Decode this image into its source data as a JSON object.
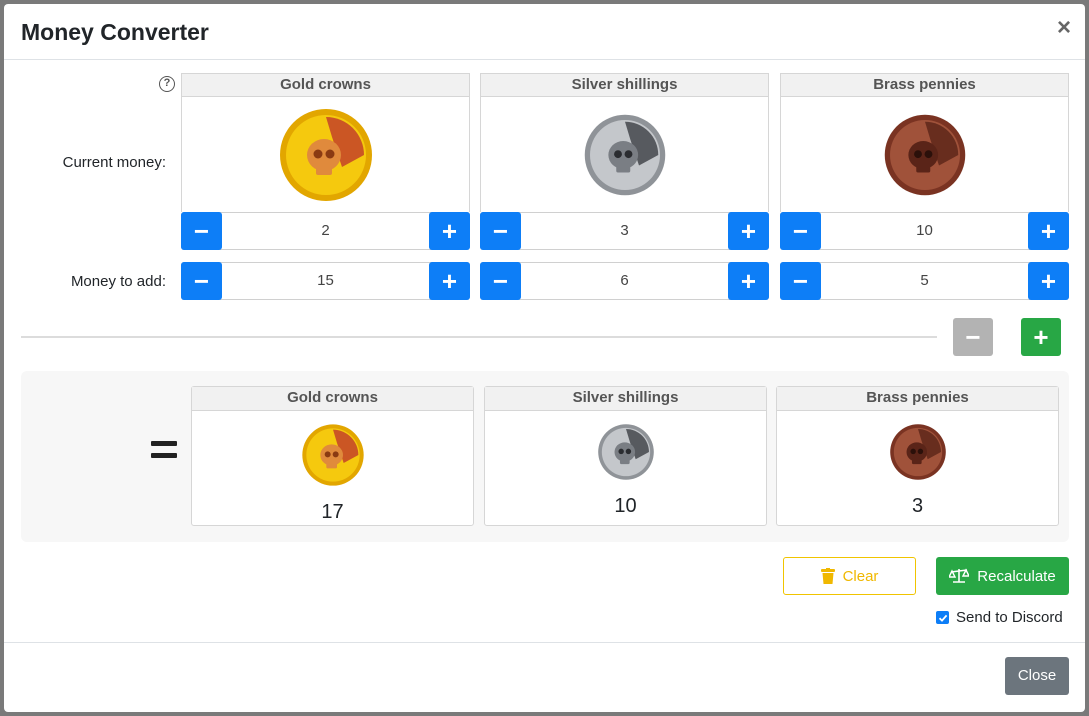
{
  "modal": {
    "title": "Money Converter",
    "close_x": "×"
  },
  "help": {
    "glyph": "?"
  },
  "labels": {
    "current": "Current money:",
    "add": "Money to add:"
  },
  "coins": [
    {
      "name": "Gold crowns",
      "color": "#f2c40c",
      "accent": "#c0392b",
      "current": "2",
      "add": "15",
      "result": "17"
    },
    {
      "name": "Silver shillings",
      "color": "#a9acb0",
      "accent": "#3c3f44",
      "current": "3",
      "add": "6",
      "result": "10"
    },
    {
      "name": "Brass pennies",
      "color": "#a0523a",
      "accent": "#5a2418",
      "current": "10",
      "add": "5",
      "result": "3"
    }
  ],
  "buttons": {
    "minus": "−",
    "plus": "+",
    "clear": "Clear",
    "recalculate": "Recalculate",
    "close": "Close"
  },
  "discord": {
    "label": "Send to Discord",
    "checked": true
  },
  "colors": {
    "primary": "#0d7ef7",
    "success": "#28a745",
    "warning": "#f0c400",
    "secondary": "#6c757d",
    "disabled": "#b3b3b3"
  }
}
